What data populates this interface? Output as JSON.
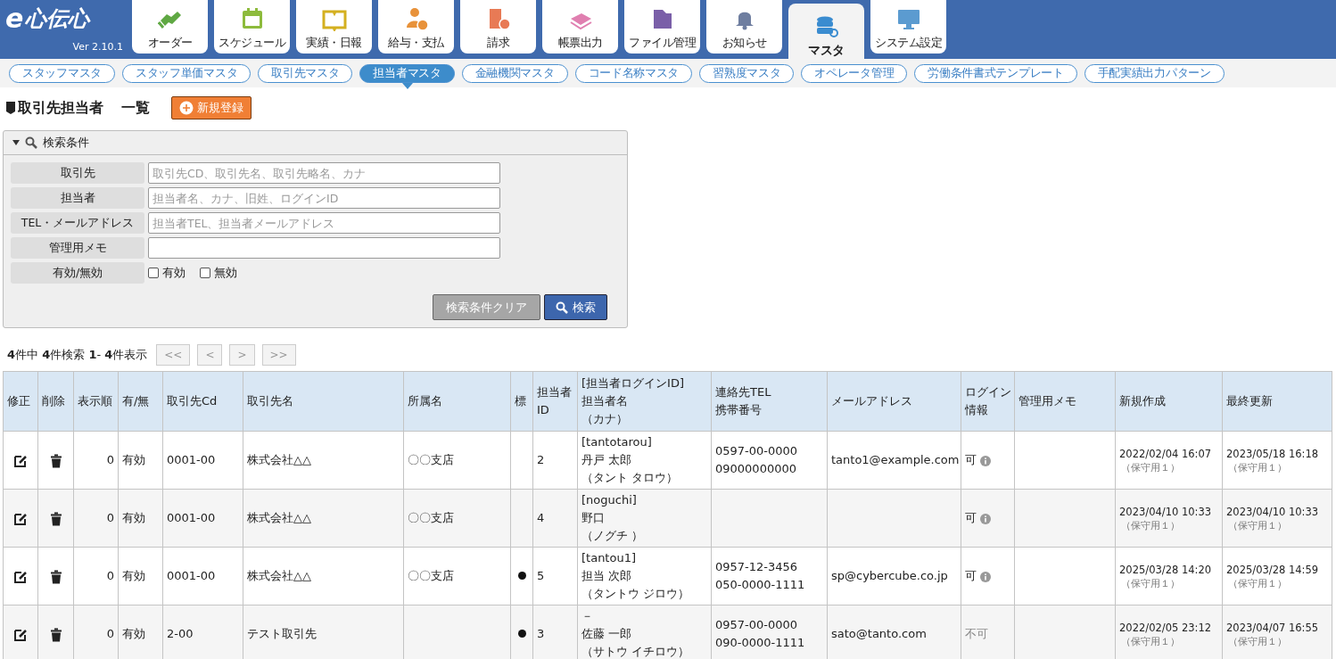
{
  "header": {
    "logo": {
      "letter": "e",
      "name": "心伝心",
      "version": "Ver 2.10.1"
    },
    "nav": [
      {
        "label": "オーダー",
        "selected": false
      },
      {
        "label": "スケジュール",
        "selected": false
      },
      {
        "label": "実績・日報",
        "selected": false
      },
      {
        "label": "給与・支払",
        "selected": false
      },
      {
        "label": "請求",
        "selected": false
      },
      {
        "label": "帳票出力",
        "selected": false
      },
      {
        "label": "ファイル管理",
        "selected": false
      },
      {
        "label": "お知らせ",
        "selected": false
      },
      {
        "label": "マスタ",
        "selected": true
      },
      {
        "label": "システム設定",
        "selected": false
      }
    ]
  },
  "subnav": [
    {
      "label": "スタッフマスタ",
      "selected": false
    },
    {
      "label": "スタッフ単価マスタ",
      "selected": false
    },
    {
      "label": "取引先マスタ",
      "selected": false
    },
    {
      "label": "担当者マスタ",
      "selected": true
    },
    {
      "label": "金融機関マスタ",
      "selected": false
    },
    {
      "label": "コード名称マスタ",
      "selected": false
    },
    {
      "label": "習熟度マスタ",
      "selected": false
    },
    {
      "label": "オペレータ管理",
      "selected": false
    },
    {
      "label": "労働条件書式テンプレート",
      "selected": false
    },
    {
      "label": "手配実績出力パターン",
      "selected": false
    }
  ],
  "page_title": {
    "title": "取引先担当者",
    "subtitle": "一覧",
    "new_button": "新規登録"
  },
  "search": {
    "title": "検索条件",
    "expanded": true,
    "fields": [
      {
        "label": "取引先",
        "placeholder": "取引先CD、取引先名、取引先略名、カナ"
      },
      {
        "label": "担当者",
        "placeholder": "担当者名、カナ、旧姓、ログインID"
      },
      {
        "label": "TEL・メールアドレス",
        "placeholder": "担当者TEL、担当者メールアドレス"
      },
      {
        "label": "管理用メモ"
      }
    ],
    "status": {
      "label": "有効/無効",
      "options": [
        {
          "label": "有効",
          "checked": false
        },
        {
          "label": "無効",
          "checked": false
        }
      ]
    },
    "clear_button": "検索条件クリア",
    "search_button": "検索"
  },
  "pagination": {
    "summary": "**4**件中 **4**件検索 **1**- **4**件表示",
    "buttons": [
      {
        "label": "<<",
        "disabled": true
      },
      {
        "label": "<",
        "disabled": true
      },
      {
        "label": ">",
        "disabled": true
      },
      {
        "label": ">>",
        "disabled": true
      }
    ]
  },
  "table": {
    "columns": [
      [
        "修正"
      ],
      [
        "削除"
      ],
      [
        "表示順"
      ],
      [
        "有/無"
      ],
      [
        "取引先Cd"
      ],
      [
        "取引先名"
      ],
      [
        "所属名"
      ],
      [
        "標"
      ],
      [
        "担当者",
        "ID"
      ],
      [
        "[担当者ログインID]",
        "担当者名",
        "（カナ）"
      ],
      [
        "連絡先TEL",
        "携帯番号"
      ],
      [
        "メールアドレス"
      ],
      [
        "ログイン",
        "情報"
      ],
      [
        "管理用メモ"
      ],
      [
        "新規作成"
      ],
      [
        "最終更新"
      ]
    ],
    "rows": [
      {
        "order": "0",
        "status": "有効",
        "code": "0001-00",
        "client": "株式会社△△",
        "branch": "〇〇支店",
        "flagged": false,
        "staff_id": "2",
        "login_id": "[tantotarou]",
        "name": "丹戸 太郎",
        "kana": "（タント タロウ）",
        "tel": "0597-00-0000",
        "mobile": "09000000000",
        "email": "tanto1@example.com",
        "login": "可",
        "login_enabled": true,
        "created": "2022/02/04 16:07",
        "created_by": "（保守用１）",
        "updated": "2023/05/18 16:18",
        "updated_by": "（保守用１）"
      },
      {
        "order": "0",
        "status": "有効",
        "code": "0001-00",
        "client": "株式会社△△",
        "branch": "〇〇支店",
        "flagged": false,
        "staff_id": "4",
        "login_id": "[noguchi]",
        "name": "野口",
        "kana": "（ノグチ ）",
        "login": "可",
        "login_enabled": true,
        "created": "2023/04/10 10:33",
        "created_by": "（保守用１）",
        "updated": "2023/04/10 10:33",
        "updated_by": "（保守用１）"
      },
      {
        "order": "0",
        "status": "有効",
        "code": "0001-00",
        "client": "株式会社△△",
        "branch": "〇〇支店",
        "flagged": true,
        "staff_id": "5",
        "login_id": "[tantou1]",
        "name": "担当 次郎",
        "kana": "（タントウ ジロウ）",
        "tel": "0957-12-3456",
        "mobile": "050-0000-1111",
        "email": "sp@cybercube.co.jp",
        "login": "可",
        "login_enabled": true,
        "created": "2025/03/28 14:20",
        "created_by": "（保守用１）",
        "updated": "2025/03/28 14:59",
        "updated_by": "（保守用１）"
      },
      {
        "order": "0",
        "status": "有効",
        "code": "2-00",
        "client": "テスト取引先",
        "flagged": true,
        "staff_id": "3",
        "login_id": "－",
        "name": "佐藤 一郎",
        "kana": "（サトウ イチロウ）",
        "tel": "0957-00-0000",
        "mobile": "090-0000-1111",
        "email": "sato@tanto.com",
        "login": "不可",
        "login_enabled": false,
        "created": "2022/02/05 23:12",
        "created_by": "（保守用１）",
        "updated": "2023/04/07 16:55",
        "updated_by": "（保守用１）"
      }
    ]
  }
}
